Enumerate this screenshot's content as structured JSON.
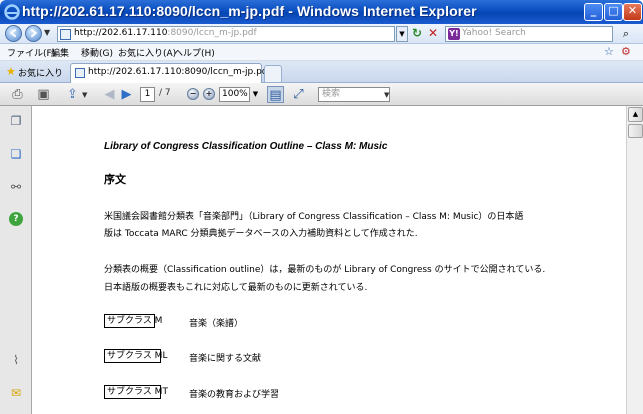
{
  "window": {
    "title": "http://202.61.17.110:8090/lccn_m-jp.pdf - Windows Internet Explorer",
    "minimize": "_",
    "maximize": "□",
    "close": "✕"
  },
  "address_bar": {
    "url_main": "http://202.61.17.110",
    "url_rest": ":8090/lccn_m-jp.pdf",
    "search_placeholder": "Yahoo! Search",
    "search_engine_label": "Y!"
  },
  "menu": {
    "file": "ファイル(F)",
    "edit": "編集",
    "go": "移動(G)",
    "favorites": "お気に入り(A)",
    "help": "ヘルプ(H)"
  },
  "tabs": {
    "favorites_label": "お気に入り",
    "active_tab_label": "http://202.61.17.110:8090/lccn_m-jp.pdf"
  },
  "pdf_toolbar": {
    "current_page": "1",
    "page_total": "/ 7",
    "zoom": "100%",
    "find_placeholder": "検索"
  },
  "document": {
    "heading": "Library of Congress Classification Outline – Class M: Music",
    "preface": "序文",
    "para1_line1": "米国議会図書館分類表「音楽部門」（Library of Congress Classification – Class M: Music）の日本語",
    "para1_line2": "版は Toccata MARC 分類典拠データベースの入力補助資料として作成された.",
    "para2_line1": "分類表の概要（Classification outline）は，最新のものが Library of Congress のサイトで公開されている.",
    "para2_line2": "日本語版の概要表もこれに対応して最新のものに更新されている.",
    "subclasses": [
      {
        "code": "サブクラス M",
        "desc": "音楽（楽譜）"
      },
      {
        "code": "サブクラス ML",
        "desc": "音楽に関する文献"
      },
      {
        "code": "サブクラス MT",
        "desc": "音楽の教育および学習"
      }
    ]
  },
  "colors": {
    "titlebar": "#0a4ec0",
    "accent": "#2f6fc7"
  }
}
